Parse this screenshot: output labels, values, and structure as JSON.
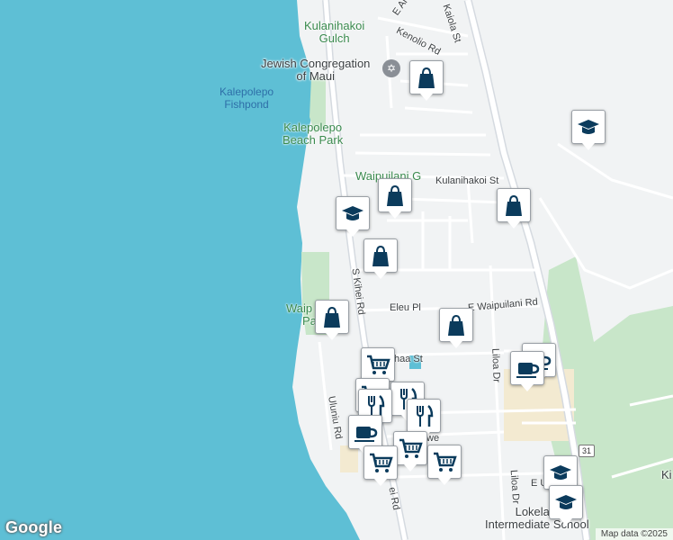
{
  "places": {
    "kulanihakoi_gulch": "Kulanihakoi\nGulch",
    "jewish_congregation": "Jewish Congregation\nof Maui",
    "kalepolepo_fishpond": "Kalepolepo\nFishpond",
    "kalepolepo_beach_park": "Kalepolepo\nBeach Park",
    "waipuilani_g": "Waipuilani G",
    "waipuilani_park": "Waip\n     Pa",
    "lokelani_school": "Lokelani\nIntermediate School",
    "ki_partial": "Ki"
  },
  "roads": {
    "kenolio_rd": "Kenolio Rd",
    "kaiola_st": "Kaiola St",
    "e_al": "E Al",
    "kulanihakoi_st": "Kulanihakoi St",
    "s_kihei_rd": "S Kihei Rd",
    "s_kihei_rd_lower": "ei Rd",
    "eleu_pl": "Eleu Pl",
    "e_waipuilani_rd": "E Waipuilani Rd",
    "haa_st": "haa St",
    "liloa_dr": "Liloa Dr",
    "liloa_dr_lower": "Liloa Dr",
    "uluniu_rd": "Uluniu Rd",
    "we": "we",
    "e_u": "E U",
    "route": "31"
  },
  "footer": {
    "logo": "Google",
    "attribution": "Map data ©2025"
  },
  "pins": [
    {
      "type": "shopping-bag-icon"
    },
    {
      "type": "school-icon"
    },
    {
      "type": "shopping-bag-icon"
    },
    {
      "type": "school-icon"
    },
    {
      "type": "shopping-bag-icon"
    },
    {
      "type": "shopping-bag-icon"
    },
    {
      "type": "shopping-bag-icon"
    },
    {
      "type": "shopping-bag-icon"
    },
    {
      "type": "cafe-icon"
    },
    {
      "type": "cafe-icon"
    },
    {
      "type": "shopping-cart-icon"
    },
    {
      "type": "shopping-cart-icon"
    },
    {
      "type": "restaurant-icon"
    },
    {
      "type": "restaurant-icon"
    },
    {
      "type": "restaurant-icon"
    },
    {
      "type": "cafe-icon"
    },
    {
      "type": "shopping-cart-icon"
    },
    {
      "type": "shopping-cart-icon"
    },
    {
      "type": "shopping-cart-icon"
    },
    {
      "type": "school-icon"
    },
    {
      "type": "school-icon"
    }
  ],
  "colors": {
    "ocean": "#5ebfd5",
    "land": "#f1f3f4",
    "park": "#c8e6c9",
    "pin_icon": "#0b3b5c",
    "commercial": "#f3ead1"
  }
}
